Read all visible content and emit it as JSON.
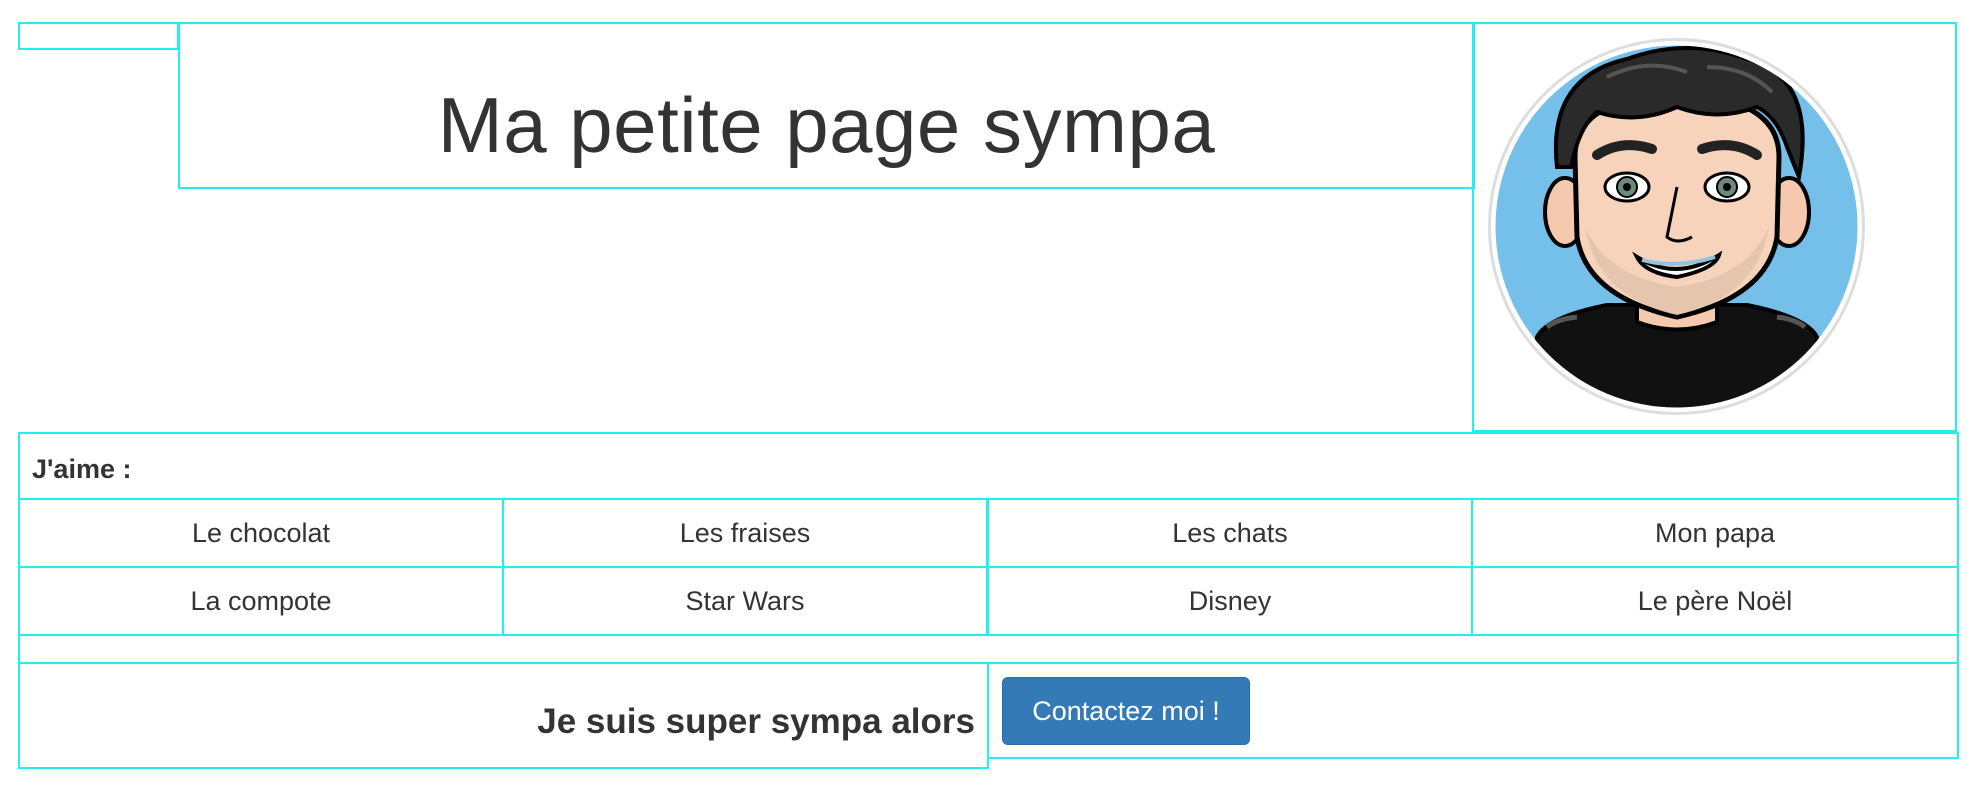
{
  "header": {
    "title": "Ma petite page sympa"
  },
  "likes": {
    "label": "J'aime :",
    "items": [
      "Le chocolat",
      "Les fraises",
      "Les chats",
      "Mon papa",
      "La compote",
      "Star Wars",
      "Disney",
      "Le père Noël"
    ]
  },
  "footer": {
    "tagline": "Je suis super sympa alors",
    "contact_button": "Contactez moi !"
  },
  "colors": {
    "border": "#22f0f0",
    "button": "#337ab7",
    "text": "#333333",
    "avatar_background": "#74c0ea"
  },
  "icons": {
    "avatar": "cartoon-man-avatar"
  }
}
